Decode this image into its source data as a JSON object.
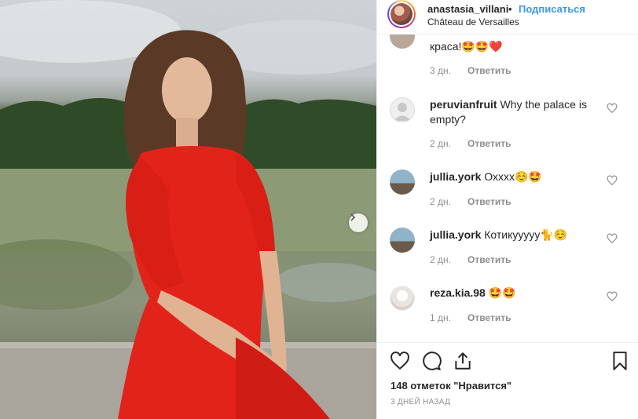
{
  "post": {
    "username": "anastasia_villani",
    "separator": "•",
    "follow_label": "Подписаться",
    "location": "Château de Versailles"
  },
  "comments": [
    {
      "username": "",
      "text": "краса!🤩🤩❤️",
      "age": "3 дн.",
      "reply": "Ответить"
    },
    {
      "username": "peruvianfruit",
      "text": "Why the palace is empty?",
      "age": "2 дн.",
      "reply": "Ответить"
    },
    {
      "username": "jullia.york",
      "text": "Охххх☺️🤩",
      "age": "2 дн.",
      "reply": "Ответить"
    },
    {
      "username": "jullia.york",
      "text": "Котикууууу🐈☺️",
      "age": "2 дн.",
      "reply": "Ответить"
    },
    {
      "username": "reza.kia.98",
      "text": "🤩🤩",
      "age": "1 дн.",
      "reply": "Ответить"
    }
  ],
  "footer": {
    "likes": "148 отметок \"Нравится\"",
    "date": "3 ДНЕЙ НАЗАД"
  },
  "icons": {
    "like": "heart-icon",
    "comment": "comment-icon",
    "share": "share-icon",
    "save": "bookmark-icon",
    "next": "chevron-right-icon"
  },
  "colors": {
    "accent": "#3897f0",
    "dress": "#e2231a",
    "muted": "#8e8e8e"
  }
}
